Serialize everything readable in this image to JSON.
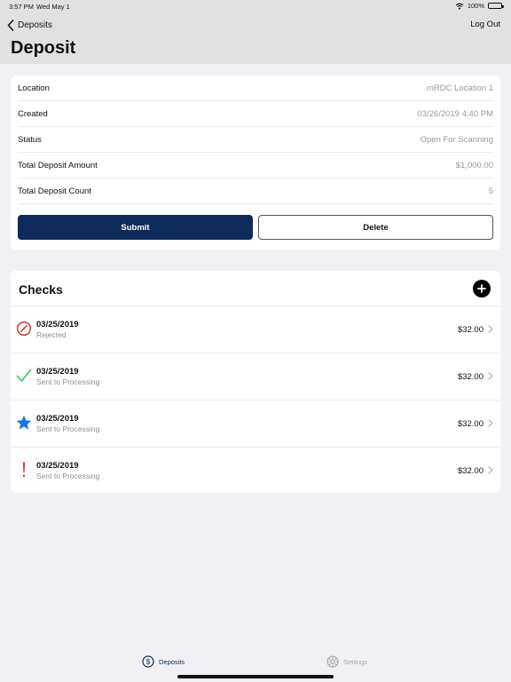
{
  "status_bar": {
    "time": "3:57 PM",
    "date": "Wed May 1",
    "battery": "100%",
    "icons": [
      "wifi-icon",
      "battery-icon"
    ]
  },
  "nav": {
    "back_label": "Deposits",
    "logout_label": "Log Out",
    "title": "Deposit"
  },
  "details": {
    "rows": [
      {
        "label": "Location",
        "value": "mRDC Location 1"
      },
      {
        "label": "Created",
        "value": "03/26/2019 4:40 PM"
      },
      {
        "label": "Status",
        "value": "Open For Scanning"
      },
      {
        "label": "Total Deposit Amount",
        "value": "$1,000.00"
      },
      {
        "label": "Total Deposit Count",
        "value": "5"
      }
    ],
    "submit_label": "Submit",
    "delete_label": "Delete"
  },
  "checks": {
    "title": "Checks",
    "items": [
      {
        "date": "03/25/2019",
        "status": "Rejected",
        "amount": "$32.00",
        "icon": "rejected-icon"
      },
      {
        "date": "03/25/2019",
        "status": "Sent to Processing",
        "amount": "$32.00",
        "icon": "checkmark-icon"
      },
      {
        "date": "03/25/2019",
        "status": "Sent to Processing",
        "amount": "$32.00",
        "icon": "star-icon"
      },
      {
        "date": "03/25/2019",
        "status": "Sent to Processing",
        "amount": "$32.00",
        "icon": "exclamation-icon"
      }
    ]
  },
  "tabs": {
    "deposits_label": "Deposits",
    "settings_label": "Settings"
  },
  "colors": {
    "primary": "#0d2b5a",
    "rejected": "#d9342b",
    "success": "#34c759",
    "star": "#1677e6",
    "warning": "#e02020",
    "inactive": "#a3a3a3"
  }
}
